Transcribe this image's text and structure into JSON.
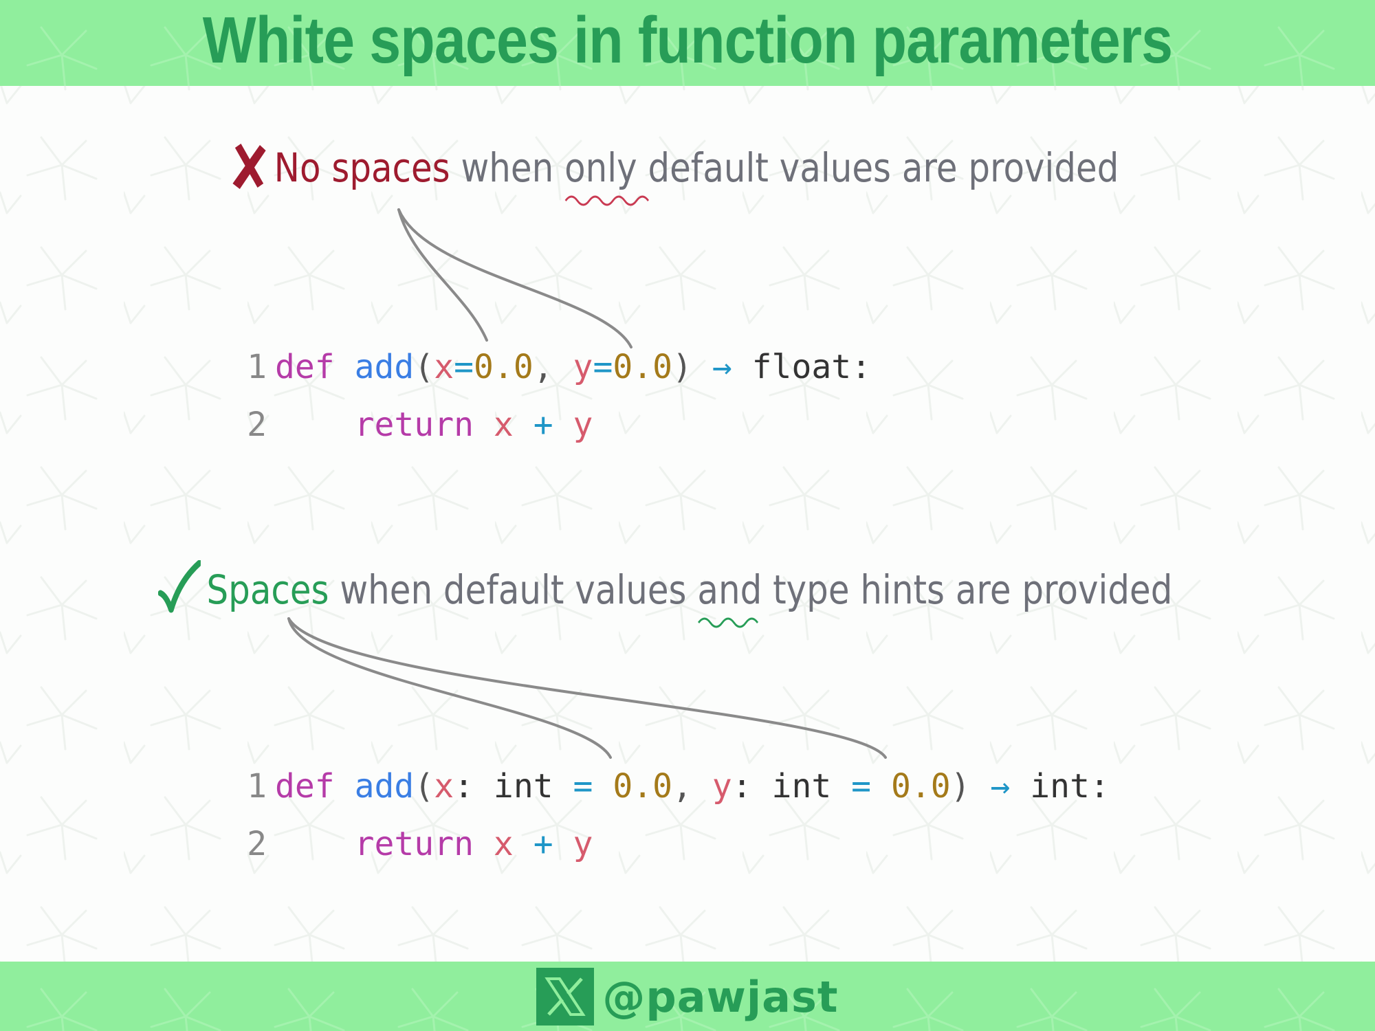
{
  "header": {
    "title": "White spaces in function parameters"
  },
  "rule_bad": {
    "marker": "✘",
    "highlight": "No spaces",
    "pre": " when ",
    "emphasis": "only",
    "post": " default values are provided"
  },
  "rule_good": {
    "marker": "✓",
    "highlight": "Spaces",
    "pre": " when default values ",
    "emphasis": "and",
    "post": " type hints are provided"
  },
  "code_bad": {
    "lines": [
      {
        "number": "1",
        "tokens": [
          {
            "t": "def",
            "c": "kw"
          },
          {
            "t": " ",
            "c": "plain"
          },
          {
            "t": "add",
            "c": "fn"
          },
          {
            "t": "(",
            "c": "par"
          },
          {
            "t": "x",
            "c": "var"
          },
          {
            "t": "=",
            "c": "op"
          },
          {
            "t": "0.0",
            "c": "num"
          },
          {
            "t": ", ",
            "c": "par"
          },
          {
            "t": "y",
            "c": "var"
          },
          {
            "t": "=",
            "c": "op"
          },
          {
            "t": "0.0",
            "c": "num"
          },
          {
            "t": ") ",
            "c": "par"
          },
          {
            "t": "→",
            "c": "op"
          },
          {
            "t": " float:",
            "c": "plain"
          }
        ]
      },
      {
        "number": "2",
        "tokens": [
          {
            "t": "    ",
            "c": "plain"
          },
          {
            "t": "return",
            "c": "kw"
          },
          {
            "t": " ",
            "c": "plain"
          },
          {
            "t": "x",
            "c": "var"
          },
          {
            "t": " ",
            "c": "plain"
          },
          {
            "t": "+",
            "c": "op"
          },
          {
            "t": " ",
            "c": "plain"
          },
          {
            "t": "y",
            "c": "var"
          }
        ]
      }
    ]
  },
  "code_good": {
    "lines": [
      {
        "number": "1",
        "tokens": [
          {
            "t": "def",
            "c": "kw"
          },
          {
            "t": " ",
            "c": "plain"
          },
          {
            "t": "add",
            "c": "fn"
          },
          {
            "t": "(",
            "c": "par"
          },
          {
            "t": "x",
            "c": "var"
          },
          {
            "t": ": ",
            "c": "plain"
          },
          {
            "t": "int",
            "c": "plain"
          },
          {
            "t": " ",
            "c": "plain"
          },
          {
            "t": "=",
            "c": "op"
          },
          {
            "t": " ",
            "c": "plain"
          },
          {
            "t": "0.0",
            "c": "num"
          },
          {
            "t": ", ",
            "c": "par"
          },
          {
            "t": "y",
            "c": "var"
          },
          {
            "t": ": ",
            "c": "plain"
          },
          {
            "t": "int",
            "c": "plain"
          },
          {
            "t": " ",
            "c": "plain"
          },
          {
            "t": "=",
            "c": "op"
          },
          {
            "t": " ",
            "c": "plain"
          },
          {
            "t": "0.0",
            "c": "num"
          },
          {
            "t": ") ",
            "c": "par"
          },
          {
            "t": "→",
            "c": "op"
          },
          {
            "t": " int:",
            "c": "plain"
          }
        ]
      },
      {
        "number": "2",
        "tokens": [
          {
            "t": "    ",
            "c": "plain"
          },
          {
            "t": "return",
            "c": "kw"
          },
          {
            "t": " ",
            "c": "plain"
          },
          {
            "t": "x",
            "c": "var"
          },
          {
            "t": " ",
            "c": "plain"
          },
          {
            "t": "+",
            "c": "op"
          },
          {
            "t": " ",
            "c": "plain"
          },
          {
            "t": "y",
            "c": "var"
          }
        ]
      }
    ]
  },
  "footer": {
    "logo_icon": "x-logo-icon",
    "handle": "@pawjast"
  },
  "colors": {
    "banner": "#90ee9d",
    "brand_green": "#279d57",
    "bad_red": "#9e1b2f",
    "text_gray": "#6e7079",
    "connector_gray": "#8a8a8a"
  }
}
